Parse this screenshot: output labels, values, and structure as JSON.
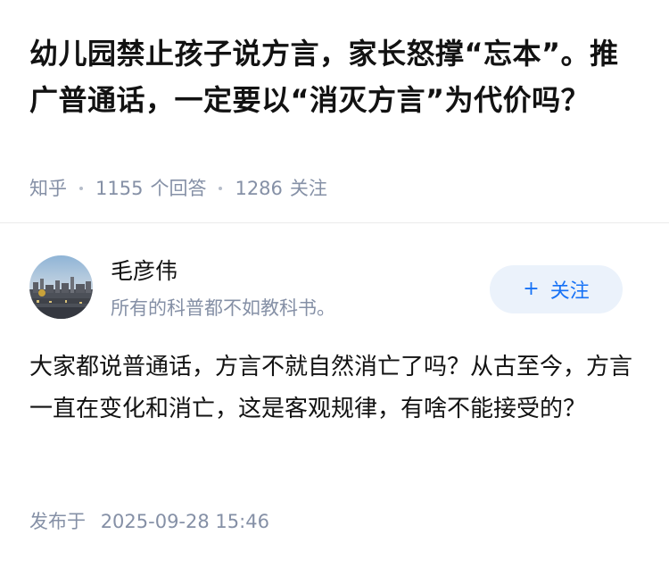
{
  "question": {
    "title": "幼儿园禁止孩子说方言，家长怒撑“忘本”。推广普通话，一定要以“消灭方言”为代价吗？",
    "source": "知乎",
    "answer_count": "1155",
    "answer_label": "个回答",
    "follower_count": "1286",
    "follower_label": "关注"
  },
  "author": {
    "name": "毛彦伟",
    "bio": "所有的科普都不如教科书。",
    "follow_plus": "+",
    "follow_label": "关注"
  },
  "answer": {
    "text": "大家都说普通话，方言不就自然消亡了吗？从古至今，方言一直在变化和消亡，这是客观规律，有啥不能接受的？"
  },
  "publish": {
    "label": "发布于",
    "datetime": "2025-09-28 15:46"
  },
  "colors": {
    "text_primary": "#121212",
    "text_secondary": "#8590a6",
    "accent": "#1772f6",
    "follow_bg": "#ebf2fb"
  }
}
